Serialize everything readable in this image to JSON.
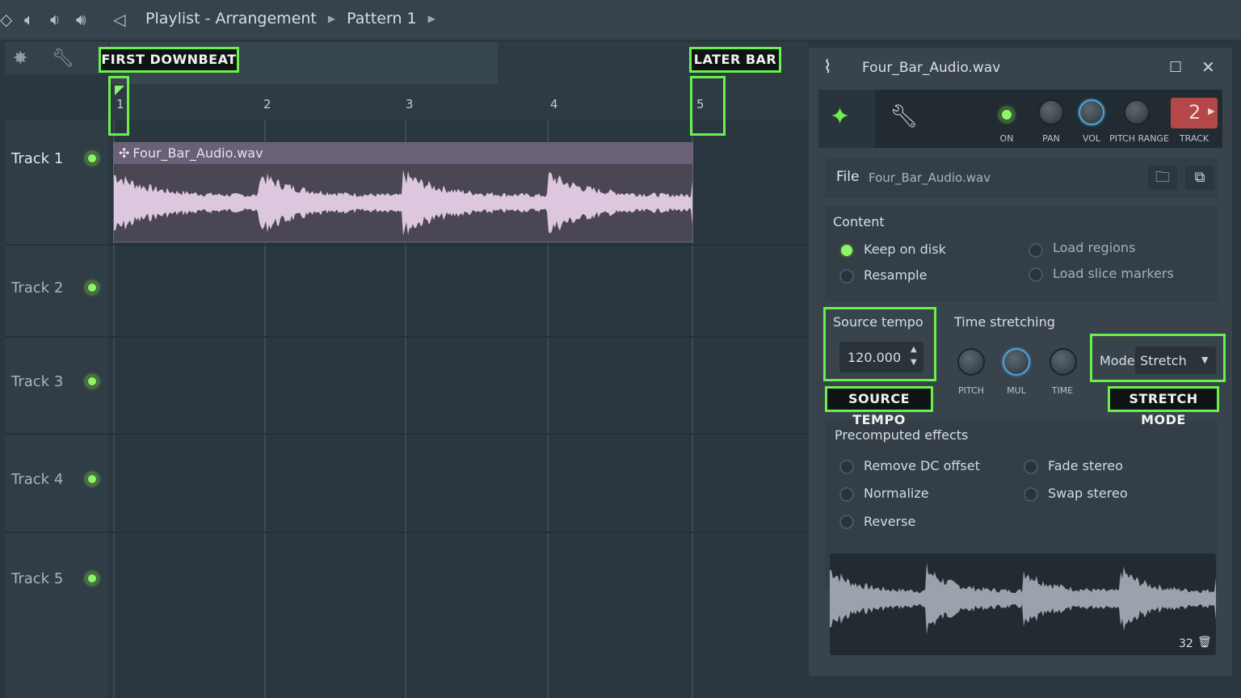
{
  "breadcrumb": {
    "playlist": "Playlist - Arrangement",
    "pattern": "Pattern 1"
  },
  "ruler": {
    "bars": [
      "1",
      "2",
      "3",
      "4",
      "5"
    ]
  },
  "tracks": [
    {
      "name": "Track 1",
      "active": true
    },
    {
      "name": "Track 2",
      "active": true
    },
    {
      "name": "Track 3",
      "active": true
    },
    {
      "name": "Track 4",
      "active": true
    },
    {
      "name": "Track 5",
      "active": true
    }
  ],
  "clip": {
    "name": "Four_Bar_Audio.wav"
  },
  "callouts": {
    "first_downbeat": "FIRST DOWNBEAT",
    "later_bar": "LATER BAR",
    "source_tempo": "SOURCE TEMPO",
    "stretch_mode": "STRETCH MODE"
  },
  "panel": {
    "title": "Four_Bar_Audio.wav",
    "controls": {
      "on": "ON",
      "pan": "PAN",
      "vol": "VOL",
      "pitch_range": "PITCH RANGE",
      "track": "TRACK",
      "track_number": "2"
    },
    "file_label": "File",
    "file_name": "Four_Bar_Audio.wav",
    "content": {
      "heading": "Content",
      "options": [
        {
          "label": "Keep on disk",
          "selected": true
        },
        {
          "label": "Resample",
          "selected": false
        },
        {
          "label": "Load regions",
          "selected": false
        },
        {
          "label": "Load slice markers",
          "selected": false
        }
      ]
    },
    "source_tempo": {
      "heading": "Source tempo",
      "value": "120.000"
    },
    "time_stretching": {
      "heading": "Time stretching",
      "knobs": [
        "PITCH",
        "MUL",
        "TIME"
      ],
      "mode_label": "Mode",
      "mode_value": "Stretch"
    },
    "precomputed": {
      "heading": "Precomputed effects",
      "options": [
        "Remove DC offset",
        "Normalize",
        "Reverse",
        "Fade stereo",
        "Swap stereo"
      ]
    },
    "waveform_zoom": "32"
  },
  "colors": {
    "accent_green": "#6af04c",
    "clip_bg": "#4a4654",
    "wave": "#dcc7de"
  }
}
